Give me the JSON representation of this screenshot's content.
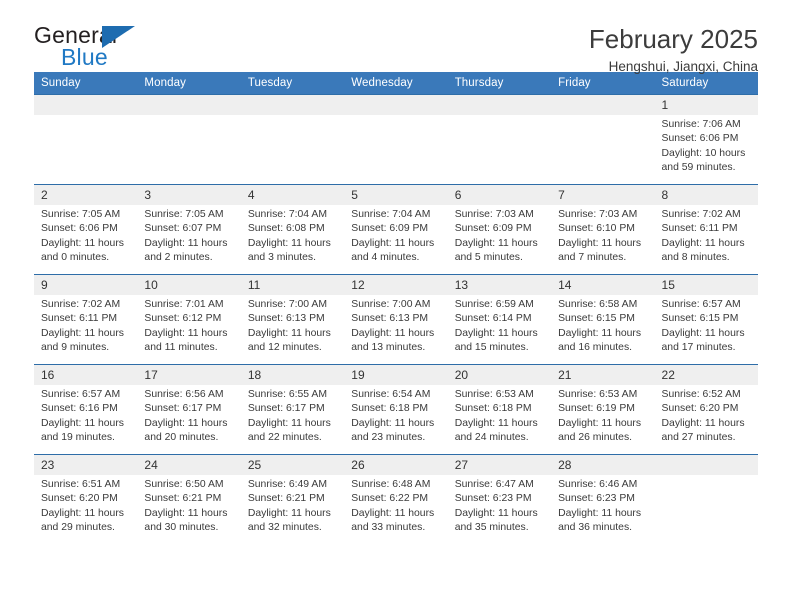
{
  "logo": {
    "text_top": "General",
    "text_bottom": "Blue",
    "flag_icon": "blue-triangle-flag-icon",
    "brand_blue": "#2079c4"
  },
  "header": {
    "title": "February 2025",
    "subtitle": "Hengshui, Jiangxi, China"
  },
  "theme": {
    "header_blue": "#3a79ba",
    "grid_line": "#2e6da8",
    "daynum_band": "#efefef"
  },
  "weekdays": [
    "Sunday",
    "Monday",
    "Tuesday",
    "Wednesday",
    "Thursday",
    "Friday",
    "Saturday"
  ],
  "weeks": [
    [
      {
        "day": "",
        "lines": []
      },
      {
        "day": "",
        "lines": []
      },
      {
        "day": "",
        "lines": []
      },
      {
        "day": "",
        "lines": []
      },
      {
        "day": "",
        "lines": []
      },
      {
        "day": "",
        "lines": []
      },
      {
        "day": "1",
        "lines": [
          "Sunrise: 7:06 AM",
          "Sunset: 6:06 PM",
          "Daylight: 10 hours",
          "and 59 minutes."
        ]
      }
    ],
    [
      {
        "day": "2",
        "lines": [
          "Sunrise: 7:05 AM",
          "Sunset: 6:06 PM",
          "Daylight: 11 hours",
          "and 0 minutes."
        ]
      },
      {
        "day": "3",
        "lines": [
          "Sunrise: 7:05 AM",
          "Sunset: 6:07 PM",
          "Daylight: 11 hours",
          "and 2 minutes."
        ]
      },
      {
        "day": "4",
        "lines": [
          "Sunrise: 7:04 AM",
          "Sunset: 6:08 PM",
          "Daylight: 11 hours",
          "and 3 minutes."
        ]
      },
      {
        "day": "5",
        "lines": [
          "Sunrise: 7:04 AM",
          "Sunset: 6:09 PM",
          "Daylight: 11 hours",
          "and 4 minutes."
        ]
      },
      {
        "day": "6",
        "lines": [
          "Sunrise: 7:03 AM",
          "Sunset: 6:09 PM",
          "Daylight: 11 hours",
          "and 5 minutes."
        ]
      },
      {
        "day": "7",
        "lines": [
          "Sunrise: 7:03 AM",
          "Sunset: 6:10 PM",
          "Daylight: 11 hours",
          "and 7 minutes."
        ]
      },
      {
        "day": "8",
        "lines": [
          "Sunrise: 7:02 AM",
          "Sunset: 6:11 PM",
          "Daylight: 11 hours",
          "and 8 minutes."
        ]
      }
    ],
    [
      {
        "day": "9",
        "lines": [
          "Sunrise: 7:02 AM",
          "Sunset: 6:11 PM",
          "Daylight: 11 hours",
          "and 9 minutes."
        ]
      },
      {
        "day": "10",
        "lines": [
          "Sunrise: 7:01 AM",
          "Sunset: 6:12 PM",
          "Daylight: 11 hours",
          "and 11 minutes."
        ]
      },
      {
        "day": "11",
        "lines": [
          "Sunrise: 7:00 AM",
          "Sunset: 6:13 PM",
          "Daylight: 11 hours",
          "and 12 minutes."
        ]
      },
      {
        "day": "12",
        "lines": [
          "Sunrise: 7:00 AM",
          "Sunset: 6:13 PM",
          "Daylight: 11 hours",
          "and 13 minutes."
        ]
      },
      {
        "day": "13",
        "lines": [
          "Sunrise: 6:59 AM",
          "Sunset: 6:14 PM",
          "Daylight: 11 hours",
          "and 15 minutes."
        ]
      },
      {
        "day": "14",
        "lines": [
          "Sunrise: 6:58 AM",
          "Sunset: 6:15 PM",
          "Daylight: 11 hours",
          "and 16 minutes."
        ]
      },
      {
        "day": "15",
        "lines": [
          "Sunrise: 6:57 AM",
          "Sunset: 6:15 PM",
          "Daylight: 11 hours",
          "and 17 minutes."
        ]
      }
    ],
    [
      {
        "day": "16",
        "lines": [
          "Sunrise: 6:57 AM",
          "Sunset: 6:16 PM",
          "Daylight: 11 hours",
          "and 19 minutes."
        ]
      },
      {
        "day": "17",
        "lines": [
          "Sunrise: 6:56 AM",
          "Sunset: 6:17 PM",
          "Daylight: 11 hours",
          "and 20 minutes."
        ]
      },
      {
        "day": "18",
        "lines": [
          "Sunrise: 6:55 AM",
          "Sunset: 6:17 PM",
          "Daylight: 11 hours",
          "and 22 minutes."
        ]
      },
      {
        "day": "19",
        "lines": [
          "Sunrise: 6:54 AM",
          "Sunset: 6:18 PM",
          "Daylight: 11 hours",
          "and 23 minutes."
        ]
      },
      {
        "day": "20",
        "lines": [
          "Sunrise: 6:53 AM",
          "Sunset: 6:18 PM",
          "Daylight: 11 hours",
          "and 24 minutes."
        ]
      },
      {
        "day": "21",
        "lines": [
          "Sunrise: 6:53 AM",
          "Sunset: 6:19 PM",
          "Daylight: 11 hours",
          "and 26 minutes."
        ]
      },
      {
        "day": "22",
        "lines": [
          "Sunrise: 6:52 AM",
          "Sunset: 6:20 PM",
          "Daylight: 11 hours",
          "and 27 minutes."
        ]
      }
    ],
    [
      {
        "day": "23",
        "lines": [
          "Sunrise: 6:51 AM",
          "Sunset: 6:20 PM",
          "Daylight: 11 hours",
          "and 29 minutes."
        ]
      },
      {
        "day": "24",
        "lines": [
          "Sunrise: 6:50 AM",
          "Sunset: 6:21 PM",
          "Daylight: 11 hours",
          "and 30 minutes."
        ]
      },
      {
        "day": "25",
        "lines": [
          "Sunrise: 6:49 AM",
          "Sunset: 6:21 PM",
          "Daylight: 11 hours",
          "and 32 minutes."
        ]
      },
      {
        "day": "26",
        "lines": [
          "Sunrise: 6:48 AM",
          "Sunset: 6:22 PM",
          "Daylight: 11 hours",
          "and 33 minutes."
        ]
      },
      {
        "day": "27",
        "lines": [
          "Sunrise: 6:47 AM",
          "Sunset: 6:23 PM",
          "Daylight: 11 hours",
          "and 35 minutes."
        ]
      },
      {
        "day": "28",
        "lines": [
          "Sunrise: 6:46 AM",
          "Sunset: 6:23 PM",
          "Daylight: 11 hours",
          "and 36 minutes."
        ]
      },
      {
        "day": "",
        "lines": []
      }
    ]
  ]
}
